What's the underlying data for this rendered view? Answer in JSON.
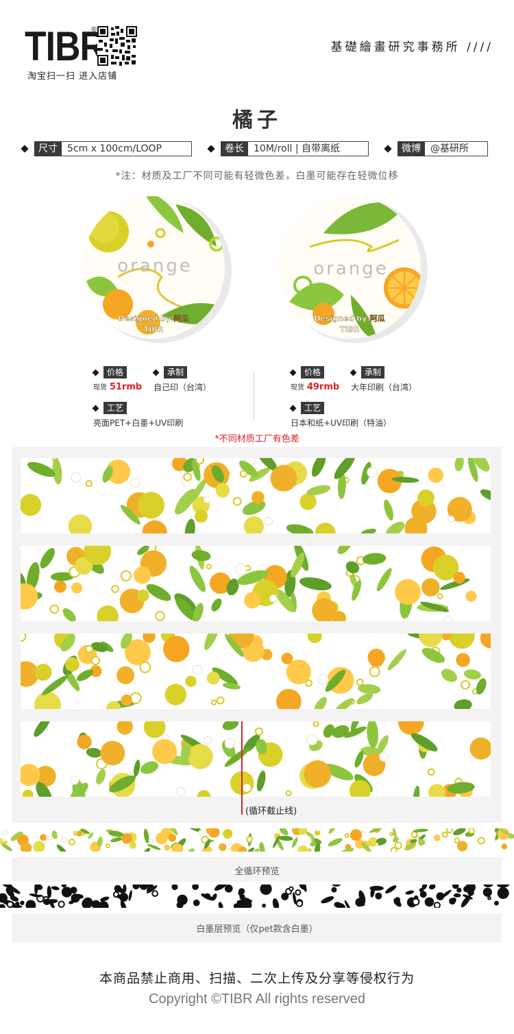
{
  "header": {
    "logo_text": "TIBR",
    "registered_mark": "®",
    "shop_link": "淘宝扫一扫  进入店铺",
    "studio_name": "基礎繪畫研究事務所 ////"
  },
  "product": {
    "title": "橘子",
    "specs": [
      {
        "label": "尺寸",
        "value": "5cm x 100cm/LOOP"
      },
      {
        "label": "卷长",
        "value": "10M/roll | 自带离纸"
      },
      {
        "label": "微博",
        "value": "@基研所"
      }
    ],
    "note": "*注：材质及工厂不同可能有轻微色差，白墨可能存在轻微位移",
    "roll_text": "orange",
    "roll_credit": "Designed by:阿瓜",
    "roll_brand": "TIBR"
  },
  "variants": [
    {
      "price_label": "价格",
      "stock_prefix": "现货",
      "price": "51rmb",
      "maker_label": "承制",
      "maker": "自己印（台湾）",
      "craft_label": "工艺",
      "craft": "亮面PET+白墨+UV印刷"
    },
    {
      "price_label": "价格",
      "stock_prefix": "现货",
      "price": "49rmb",
      "maker_label": "承制",
      "maker": "大年印刷（台湾）",
      "craft_label": "工艺",
      "craft": "日本和纸+UV印刷（特油）"
    }
  ],
  "color_warning": "*不同材质工厂有色差",
  "loop_cut_label": "(循环截止线)",
  "full_loop_label": "全循环预览",
  "white_ink_label": "白墨层预览（仅pet款含白墨）",
  "footer": {
    "notice": "本商品禁止商用、扫描、二次上传及分享等侵权行为",
    "copyright": "Copyright ©TIBR All rights reserved"
  },
  "colors": {
    "accent_red": "#e02020",
    "tag_bg": "#3a3a3a",
    "orange": "#f5a623",
    "leaf": "#8cc63f",
    "cut_line": "#d6232a"
  }
}
